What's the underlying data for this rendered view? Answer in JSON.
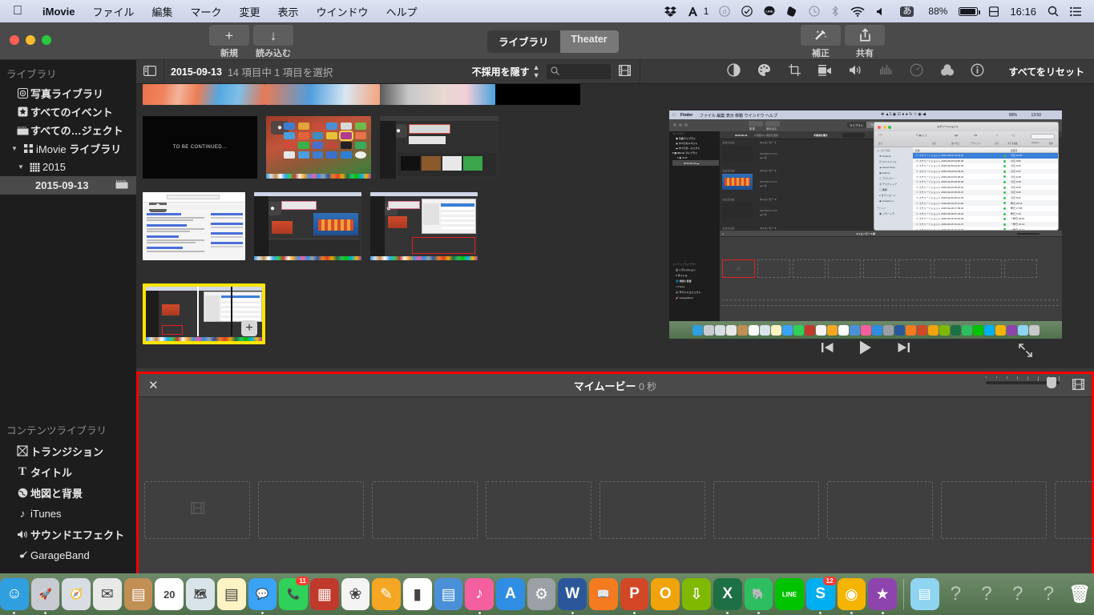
{
  "menubar": {
    "apple_icon": "apple-icon",
    "items": [
      {
        "label": "iMovie",
        "bold": true
      },
      {
        "label": "ファイル"
      },
      {
        "label": "編集"
      },
      {
        "label": "マーク"
      },
      {
        "label": "変更"
      },
      {
        "label": "表示"
      },
      {
        "label": "ウインドウ"
      },
      {
        "label": "ヘルプ"
      }
    ],
    "status": {
      "dropbox": "dropbox-icon",
      "adobe": "adobe-creative-cloud-icon",
      "adobe_count": "1",
      "dashlane": "dashlane-icon",
      "checkmark": "checkmark-circle-icon",
      "line": "line-icon",
      "evernote": "evernote-icon",
      "timemachine": "time-machine-icon",
      "bluetooth": "bluetooth-icon",
      "wifi": "wifi-icon",
      "volume": "volume-icon",
      "ime": "あ",
      "battery_percent": "88%",
      "clock_icon": "calendar-icon",
      "clock": "16:16",
      "spotlight": "search-icon",
      "notification": "notification-center-icon"
    }
  },
  "toolbar": {
    "new_icon": "plus-icon",
    "new_label": "新規",
    "import_icon": "download-arrow-icon",
    "import_label": "読み込む",
    "segments": [
      {
        "label": "ライブラリ",
        "selected": true
      },
      {
        "label": "Theater",
        "selected": false
      }
    ],
    "enhance_icon": "magic-wand-icon",
    "enhance_label": "補正",
    "share_icon": "share-icon",
    "share_label": "共有"
  },
  "browser_toolbar": {
    "sidebar_toggle_icon": "sidebar-toggle-icon",
    "date": "2015-09-13",
    "count_text": "14 項目中 1 項目を選択",
    "filter_label": "不採用を隠す",
    "stepper_icon": "stepper-updown-icon",
    "search_icon": "search-icon",
    "search_value": "",
    "search_placeholder": "",
    "filmstrip_icon": "filmstrip-icon",
    "adjust_icons": [
      {
        "name": "color-balance-icon",
        "dim": false
      },
      {
        "name": "color-correction-icon",
        "dim": false
      },
      {
        "name": "crop-icon",
        "dim": false
      },
      {
        "name": "stabilization-icon",
        "dim": false
      },
      {
        "name": "volume-icon",
        "dim": false
      },
      {
        "name": "equalizer-icon",
        "dim": true
      },
      {
        "name": "speed-icon",
        "dim": true
      },
      {
        "name": "filter-icon",
        "dim": false
      },
      {
        "name": "info-icon",
        "dim": false
      }
    ],
    "reset_label": "すべてをリセット"
  },
  "sidebar": {
    "library_header": "ライブラリ",
    "library_items": [
      {
        "label": "写真ライブラリ",
        "icon": "photos-library-icon",
        "indent": 1,
        "selected": false,
        "twisty": ""
      },
      {
        "label": "すべてのイベント",
        "icon": "star-events-icon",
        "indent": 1,
        "selected": false,
        "twisty": ""
      },
      {
        "label": "すべての…ジェクト",
        "icon": "projects-icon",
        "indent": 1,
        "selected": false,
        "twisty": ""
      },
      {
        "label": "iMovie ライブラリ",
        "icon": "imovie-library-icon",
        "indent": 0,
        "selected": false,
        "twisty": "▼"
      },
      {
        "label": "2015",
        "icon": "calendar-grid-icon",
        "indent": 1,
        "selected": false,
        "twisty": "▼"
      },
      {
        "label": "2015-09-13",
        "icon": "clapperboard-icon",
        "indent": 2,
        "selected": true,
        "twisty": ""
      }
    ],
    "content_header": "コンテンツライブラリ",
    "content_items": [
      {
        "label": "トランジション",
        "icon": "transition-icon"
      },
      {
        "label": "タイトル",
        "icon": "title-T-icon"
      },
      {
        "label": "地図と背景",
        "icon": "globe-icon"
      },
      {
        "label": "iTunes",
        "icon": "music-note-icon"
      },
      {
        "label": "サウンドエフェクト",
        "icon": "speaker-icon"
      },
      {
        "label": "GarageBand",
        "icon": "guitar-icon"
      }
    ]
  },
  "browser": {
    "clips": [
      {
        "name": "clip-vocaloid-strip",
        "row": 0
      },
      {
        "name": "clip-to-be-continued",
        "row": 1,
        "caption": "TO BE CONTINUED..."
      },
      {
        "name": "clip-launchpad-screenshot",
        "row": 1
      },
      {
        "name": "clip-imovie-screenshot",
        "row": 1
      },
      {
        "name": "clip-google-search-screenshot",
        "row": 2
      },
      {
        "name": "clip-imovie-project-screenshot",
        "row": 2
      },
      {
        "name": "clip-imovie-finder-screenshot",
        "row": 2
      },
      {
        "name": "clip-selected-screenshot",
        "row": 3,
        "selected": true
      }
    ]
  },
  "viewer": {
    "content_name": "nested-imovie-finder-screenshot",
    "nested": {
      "menu_app": "Finder",
      "menu_items": [
        "ファイル",
        "編集",
        "表示",
        "移動",
        "ウインドウ",
        "ヘルプ"
      ],
      "clock": "13:50",
      "battery": "89%",
      "window_title": "スクリーンショット",
      "segments": [
        "ライブラリ",
        "Theater"
      ],
      "browser_date": "2015-09-13",
      "browser_count": "9 項目中 1 項目を選択",
      "filter": "不採用を隠す",
      "sidebar_header": "ライブラリ",
      "sidebar_items": [
        "写真ライブラリ",
        "すべてのイベント",
        "すべての…ジェクト",
        "iMovie ライブラリ",
        "2015",
        "2015-09-13"
      ],
      "content_header": "コンテンツライブラリ",
      "content_items": [
        "トランジション",
        "タイトル",
        "地図と背景",
        "iTunes",
        "サウンドエフェクト",
        "GarageBand"
      ],
      "movies": [
        {
          "name": "マイムービー 1",
          "date": "2015/09/13 10:43",
          "dur": "0 秒"
        },
        {
          "name": "マイムービー 2",
          "date": "2015/09/13 11:25",
          "dur": "5 秒"
        },
        {
          "name": "マイムービー 3",
          "date": "2015/09/13 11:58",
          "dur": "0 秒"
        },
        {
          "name": "マイムービー 4",
          "date": "",
          "dur": ""
        }
      ],
      "timeline_title": "マイムービー",
      "timeline_dur": "0 秒",
      "finder_sidebar_header": "よく使う項目",
      "finder_sidebar": [
        "Dropbox",
        "マイファイル",
        "iCloud Drive",
        "AirDrop",
        "アプリケー…",
        "デスクトップ",
        "書類",
        "ダウンロード",
        "Creative C…"
      ],
      "finder_devices_header": "デバイス",
      "finder_devices": [
        "リモートデ…"
      ],
      "finder_col_name": "名前",
      "finder_col_date": "変更日",
      "finder_toolbar": [
        "戻る",
        "表示",
        "並べ替え",
        "アクション",
        "共有",
        "タグを編集",
        "Dropbox",
        "検索"
      ],
      "finder_rows": [
        {
          "name": "スクリーンショット 2015-09-20 13.44.37",
          "date": "今日 13:45",
          "selected": true
        },
        {
          "name": "スクリーンショット 2015-09-20 09.56.40",
          "date": "今日 9:56"
        },
        {
          "name": "スクリーンショット 2015-09-20 09.41.39",
          "date": "今日 9:43"
        },
        {
          "name": "スクリーンショット 2015-09-20 09.36.23",
          "date": "今日 9:37"
        },
        {
          "name": "スクリーンショット 2015-09-20 09.48.23",
          "date": "今日 9:49"
        },
        {
          "name": "スクリーンショット 2015-09-20 08.45.36",
          "date": "今日 9:45"
        },
        {
          "name": "スクリーンショット 2015-09-20 08.46.51",
          "date": "今日 8:46"
        },
        {
          "name": "スクリーンショット 2015-09-20 08.45.47",
          "date": "今日 8:45"
        },
        {
          "name": "スクリーンショット 2015-09-20 08.41.45",
          "date": "今日 8:41"
        },
        {
          "name": "スクリーンショット 2015-09-19 20.11.30",
          "date": "昨日 20:16"
        },
        {
          "name": "スクリーンショット 2015-09-18 17.58.22",
          "date": "昨日 17:58"
        },
        {
          "name": "スクリーンショット 2015-09-18 07.24.22",
          "date": "昨日 7:24"
        },
        {
          "name": "スクリーンショット 2015-09-16 20.52.46",
          "date": "一昨日 20:52"
        },
        {
          "name": "スクリーンショット 2015-09-16 19.12.27",
          "date": "一昨日 19:12"
        },
        {
          "name": "スクリーンショット 2015-09-16 19.10.34",
          "date": "一昨日 19:10"
        }
      ]
    },
    "controls": {
      "prev_icon": "skip-previous-icon",
      "play_icon": "play-icon",
      "next_icon": "skip-next-icon",
      "fullscreen_icon": "fullscreen-icon"
    }
  },
  "timeline": {
    "close_icon": "close-x-icon",
    "title": "マイムービー",
    "duration": "0 秒",
    "zoom_slider_icon": "zoom-slider-icon",
    "filmstrip_icon": "filmstrip-settings-icon",
    "dropzone_count": 9,
    "dropzone_icon": "filmstrip-placeholder-icon",
    "audio_icon": "music-note-icon"
  },
  "dock": {
    "apps": [
      {
        "name": "finder",
        "glyph": "☺",
        "bg": "#2f9fe0",
        "running": true
      },
      {
        "name": "launchpad",
        "glyph": "🚀",
        "bg": "#c8ccd2",
        "running": true
      },
      {
        "name": "safari",
        "glyph": "🧭",
        "bg": "#d8dde4",
        "running": false
      },
      {
        "name": "mail",
        "glyph": "✉",
        "bg": "#e8e8e8",
        "running": false
      },
      {
        "name": "contacts",
        "glyph": "▤",
        "bg": "#c18e53",
        "running": false
      },
      {
        "name": "calendar",
        "glyph": "20",
        "bg": "#ffffff",
        "running": false
      },
      {
        "name": "maps",
        "glyph": "🗺",
        "bg": "#d8e4ea",
        "running": false
      },
      {
        "name": "notes",
        "glyph": "▤",
        "bg": "#fdf3c4",
        "running": false
      },
      {
        "name": "messages",
        "glyph": "💬",
        "bg": "#3aa3f5",
        "running": true
      },
      {
        "name": "facetime",
        "glyph": "📞",
        "bg": "#2fd158",
        "running": false,
        "badge": "11"
      },
      {
        "name": "photo-booth",
        "glyph": "▦",
        "bg": "#c0392b",
        "running": false
      },
      {
        "name": "photos",
        "glyph": "❀",
        "bg": "#f4f4f4",
        "running": false
      },
      {
        "name": "pages",
        "glyph": "✎",
        "bg": "#f5a623",
        "running": false
      },
      {
        "name": "numbers",
        "glyph": "▮",
        "bg": "#ffffff",
        "running": false
      },
      {
        "name": "keynote",
        "glyph": "▤",
        "bg": "#4a90d9",
        "running": false
      },
      {
        "name": "itunes",
        "glyph": "♪",
        "bg": "#f45fa0",
        "running": true
      },
      {
        "name": "app-store",
        "glyph": "A",
        "bg": "#2f8de4",
        "running": false
      },
      {
        "name": "system-preferences",
        "glyph": "⚙",
        "bg": "#9aa0a6",
        "running": false
      },
      {
        "name": "word",
        "glyph": "W",
        "bg": "#2b579a",
        "running": true
      },
      {
        "name": "ibooks",
        "glyph": "📖",
        "bg": "#f47b20",
        "running": false
      },
      {
        "name": "powerpoint",
        "glyph": "P",
        "bg": "#d24726",
        "running": true
      },
      {
        "name": "outlook",
        "glyph": "O",
        "bg": "#f0a30a",
        "running": false
      },
      {
        "name": "download-helper",
        "glyph": "⇩",
        "bg": "#7fb800",
        "running": false
      },
      {
        "name": "excel",
        "glyph": "X",
        "bg": "#1d7044",
        "running": true
      },
      {
        "name": "evernote",
        "glyph": "🐘",
        "bg": "#2dbe60",
        "running": true
      },
      {
        "name": "line",
        "glyph": "LINE",
        "bg": "#00c300",
        "running": false
      },
      {
        "name": "skype",
        "glyph": "S",
        "bg": "#00aff0",
        "running": true,
        "badge": "12"
      },
      {
        "name": "chrome",
        "glyph": "◉",
        "bg": "#f4b400",
        "running": true
      },
      {
        "name": "imovie",
        "glyph": "★",
        "bg": "#8e44ad",
        "running": true
      }
    ],
    "stack_icon": "documents-stack-icon",
    "placeholders": [
      "?",
      "?",
      "?",
      "?"
    ],
    "trash_icon": "trash-icon"
  }
}
